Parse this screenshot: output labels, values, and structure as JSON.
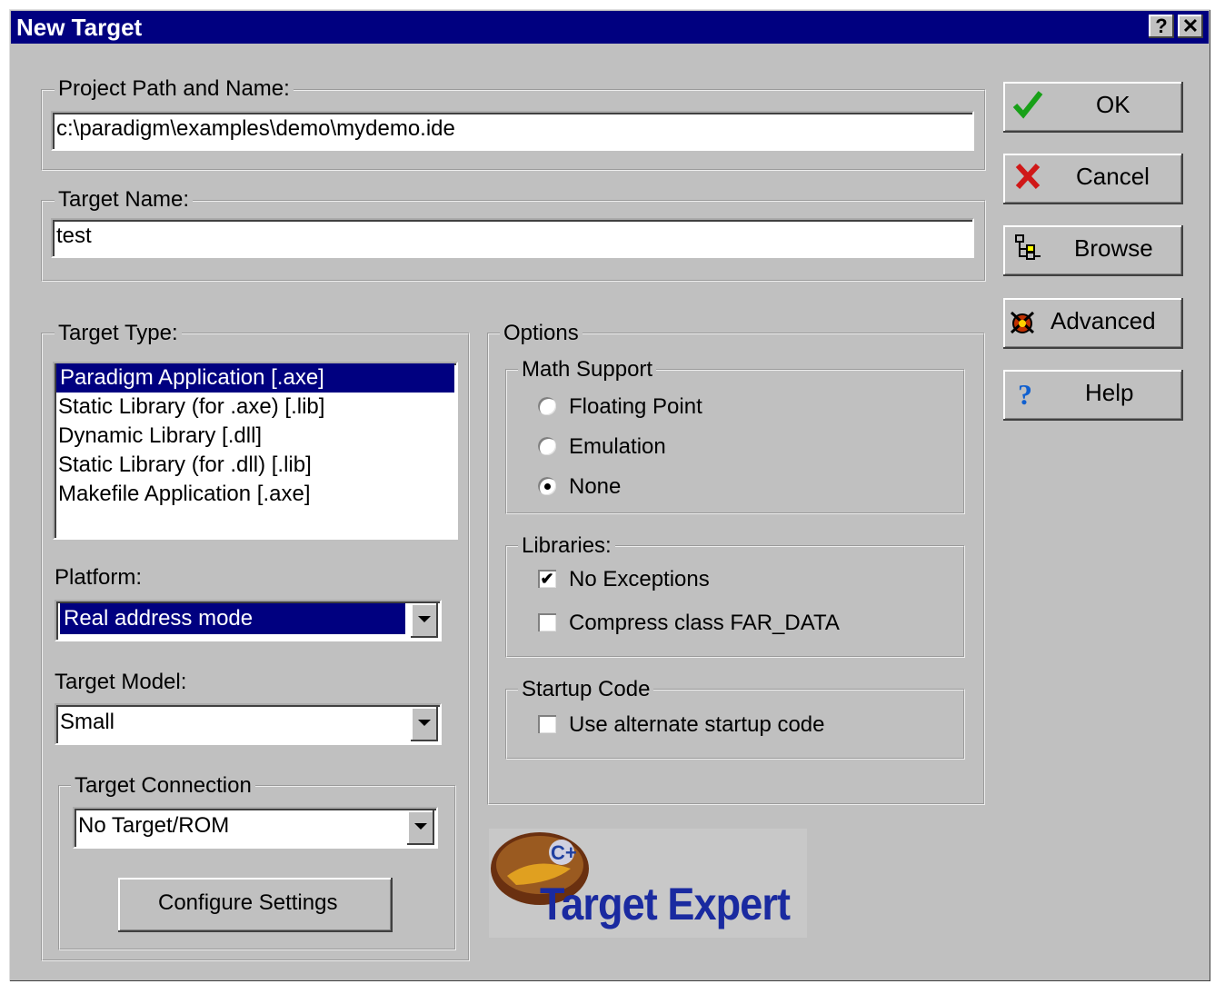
{
  "window": {
    "title": "New Target",
    "help_glyph": "?",
    "close_glyph": "✕"
  },
  "project_path": {
    "legend": "Project Path and Name:",
    "value": "c:\\paradigm\\examples\\demo\\mydemo.ide"
  },
  "target_name": {
    "legend": "Target Name:",
    "value": "test"
  },
  "buttons": {
    "ok": "OK",
    "cancel": "Cancel",
    "browse": "Browse",
    "advanced": "Advanced",
    "help": "Help"
  },
  "target_type": {
    "legend": "Target Type:",
    "items": [
      "Paradigm Application [.axe]",
      "Static Library (for .axe) [.lib]",
      "Dynamic Library [.dll]",
      "Static Library (for .dll) [.lib]",
      "Makefile Application [.axe]"
    ],
    "selected_index": 0
  },
  "platform": {
    "label": "Platform:",
    "value": "Real address mode"
  },
  "target_model": {
    "label": "Target Model:",
    "value": "Small"
  },
  "target_connection": {
    "legend": "Target Connection",
    "value": "No Target/ROM",
    "configure_label": "Configure Settings"
  },
  "options": {
    "legend": "Options",
    "math_support": {
      "legend": "Math Support",
      "choices": [
        "Floating Point",
        "Emulation",
        "None"
      ],
      "selected": "None"
    },
    "libraries": {
      "legend": "Libraries:",
      "no_exceptions": {
        "label": "No Exceptions",
        "checked": true
      },
      "compress_far_data": {
        "label": "Compress class FAR_DATA",
        "checked": false
      }
    },
    "startup_code": {
      "legend": "Startup Code",
      "use_alternate": {
        "label": "Use alternate startup code",
        "checked": false
      }
    }
  },
  "logo": {
    "text": "Target Expert"
  },
  "colors": {
    "titlebar": "#000080",
    "face": "#c0c0c0",
    "selection": "#000080",
    "ok_check": "#18a018",
    "cancel_x": "#d01818",
    "help_q": "#1060d0",
    "logo_text": "#1a2aa0"
  },
  "check_glyph": "✔"
}
